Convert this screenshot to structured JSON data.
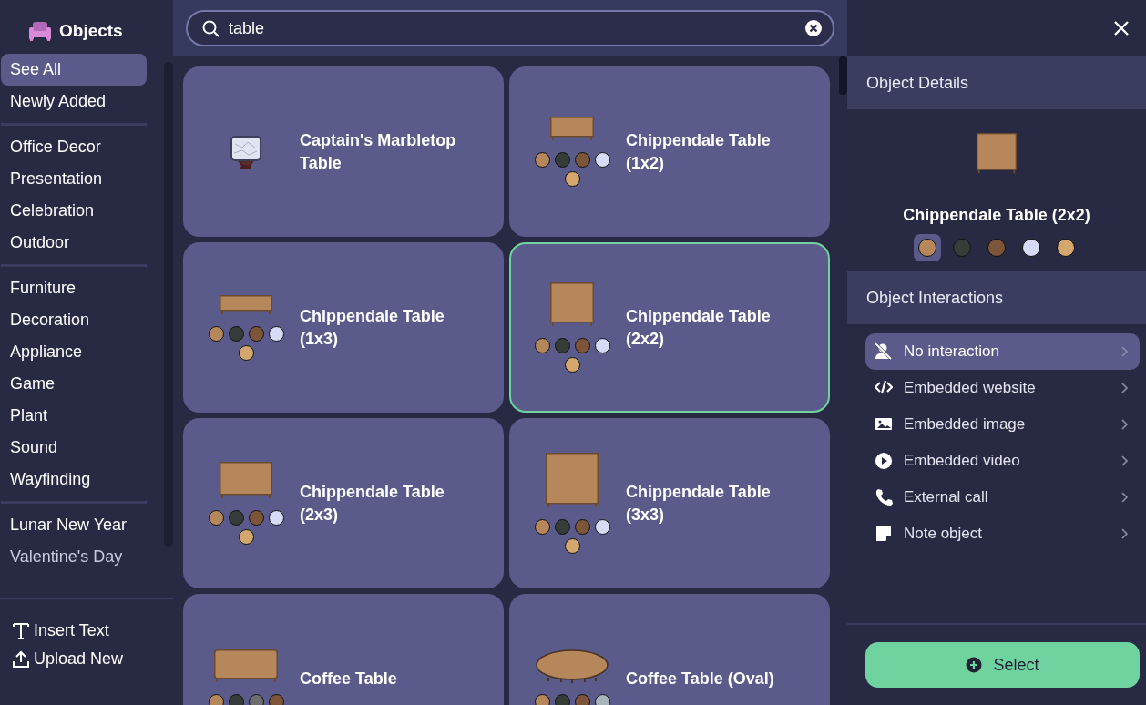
{
  "sidebar": {
    "title": "Objects",
    "groups": [
      {
        "items": [
          {
            "label": "See All",
            "selected": true
          },
          {
            "label": "Newly Added",
            "selected": false
          }
        ]
      },
      {
        "items": [
          {
            "label": "Office Decor",
            "selected": false
          },
          {
            "label": "Presentation",
            "selected": false
          },
          {
            "label": "Celebration",
            "selected": false
          },
          {
            "label": "Outdoor",
            "selected": false
          }
        ]
      },
      {
        "items": [
          {
            "label": "Furniture",
            "selected": false
          },
          {
            "label": "Decoration",
            "selected": false
          },
          {
            "label": "Appliance",
            "selected": false
          },
          {
            "label": "Game",
            "selected": false
          },
          {
            "label": "Plant",
            "selected": false
          },
          {
            "label": "Sound",
            "selected": false
          },
          {
            "label": "Wayfinding",
            "selected": false
          }
        ]
      },
      {
        "items": [
          {
            "label": "Lunar New Year",
            "selected": false
          },
          {
            "label": "Valentine's Day",
            "selected": false
          }
        ]
      }
    ],
    "actions": [
      {
        "kind": "text",
        "label": "Insert Text"
      },
      {
        "kind": "upload",
        "label": "Upload New"
      }
    ]
  },
  "search": {
    "value": "table"
  },
  "cards": [
    {
      "name": "Captain's Marbletop Table",
      "kind": "marble",
      "selected": false
    },
    {
      "name": "Chippendale Table (1x2)",
      "kind": "wide",
      "selected": false,
      "swatches": [
        {
          "color": "#b5875a"
        },
        {
          "color": "#363d38"
        },
        {
          "color": "#7d5538"
        },
        {
          "color": "#d6dcf6"
        },
        {
          "color": "#d4a76e"
        }
      ]
    },
    {
      "name": "Chippendale Table (1x3)",
      "kind": "long",
      "selected": false,
      "swatches": [
        {
          "color": "#b5875a"
        },
        {
          "color": "#363d38"
        },
        {
          "color": "#7d5538"
        },
        {
          "color": "#d6dcf6"
        },
        {
          "color": "#d4a76e"
        }
      ]
    },
    {
      "name": "Chippendale Table (2x2)",
      "kind": "square",
      "selected": true,
      "swatches": [
        {
          "color": "#b5875a"
        },
        {
          "color": "#363d38"
        },
        {
          "color": "#7d5538"
        },
        {
          "color": "#d6dcf6"
        },
        {
          "color": "#d4a76e"
        }
      ]
    },
    {
      "name": "Chippendale Table (2x3)",
      "kind": "deep",
      "selected": false,
      "swatches": [
        {
          "color": "#b5875a"
        },
        {
          "color": "#363d38"
        },
        {
          "color": "#7d5538"
        },
        {
          "color": "#d6dcf6"
        },
        {
          "color": "#d4a76e"
        }
      ]
    },
    {
      "name": "Chippendale Table (3x3)",
      "kind": "big",
      "selected": false,
      "swatches": [
        {
          "color": "#b5875a"
        },
        {
          "color": "#363d38"
        },
        {
          "color": "#7d5538"
        },
        {
          "color": "#d6dcf6"
        },
        {
          "color": "#d4a76e"
        }
      ]
    },
    {
      "name": "Coffee Table",
      "kind": "coffee",
      "selected": false,
      "swatches": [
        {
          "color": "#b5875a"
        },
        {
          "color": "#363d38"
        },
        {
          "color": "#6e6e6e"
        },
        {
          "color": "#7d5538"
        }
      ]
    },
    {
      "name": "Coffee Table (Oval)",
      "kind": "oval",
      "selected": false,
      "swatches": [
        {
          "color": "#b5875a"
        },
        {
          "color": "#363d38"
        },
        {
          "color": "#7d5538"
        },
        {
          "color": "#a9b3bb"
        }
      ]
    }
  ],
  "details": {
    "heading": "Object Details",
    "kind": "square",
    "name": "Chippendale Table (2x2)",
    "swatches": [
      {
        "color": "#b5875a",
        "selected": true
      },
      {
        "color": "#363d38",
        "selected": false
      },
      {
        "color": "#7d5538",
        "selected": false
      },
      {
        "color": "#d6dcf6",
        "selected": false
      },
      {
        "color": "#d4a76e",
        "selected": false
      }
    ]
  },
  "interactions": {
    "heading": "Object Interactions",
    "items": [
      {
        "kind": "none",
        "label": "No interaction",
        "selected": true
      },
      {
        "kind": "website",
        "label": "Embedded website",
        "selected": false
      },
      {
        "kind": "image",
        "label": "Embedded image",
        "selected": false
      },
      {
        "kind": "video",
        "label": "Embedded video",
        "selected": false
      },
      {
        "kind": "call",
        "label": "External call",
        "selected": false
      },
      {
        "kind": "note",
        "label": "Note object",
        "selected": false
      }
    ]
  },
  "select_button": {
    "label": "Select"
  }
}
